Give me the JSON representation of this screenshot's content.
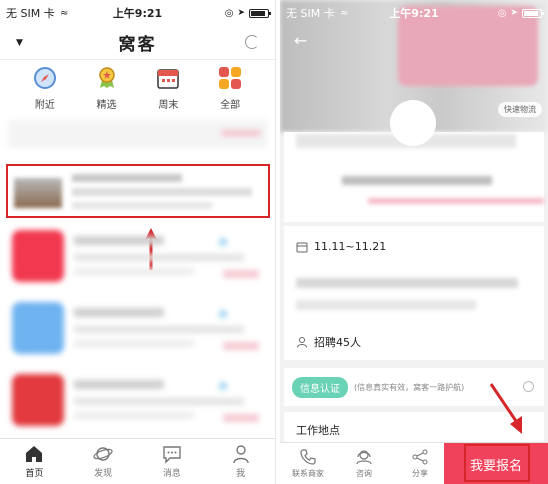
{
  "left": {
    "status": {
      "carrier": "无 SIM 卡",
      "time": "上午9:21"
    },
    "header": {
      "title": "窝客"
    },
    "categories": [
      {
        "label": "附近",
        "icon": "compass-icon"
      },
      {
        "label": "精选",
        "icon": "medal-icon"
      },
      {
        "label": "周末",
        "icon": "calendar-icon"
      },
      {
        "label": "全部",
        "icon": "grid-icon"
      }
    ],
    "tabs": [
      {
        "label": "首页",
        "icon": "home-icon"
      },
      {
        "label": "发现",
        "icon": "planet-icon"
      },
      {
        "label": "消息",
        "icon": "message-icon"
      },
      {
        "label": "我",
        "icon": "person-icon"
      }
    ],
    "colors": {
      "highlight": "#d6262a"
    }
  },
  "right": {
    "status": {
      "carrier": "无 SIM 卡",
      "time": "上午9:21"
    },
    "express_badge": "快速物流",
    "date_range": "11.11~11.21",
    "recruit": "招聘45人",
    "verify_badge": "信息认证",
    "verify_text": "(信息真实有效，窝客一路护航)",
    "work_location": "工作地点",
    "actions": [
      {
        "label": "联系商家",
        "icon": "phone-icon"
      },
      {
        "label": "咨询",
        "icon": "headset-icon"
      },
      {
        "label": "分享",
        "icon": "share-icon"
      }
    ],
    "signup": "我要报名",
    "colors": {
      "accent": "#f1425c",
      "verify": "#6ad3b5"
    }
  }
}
